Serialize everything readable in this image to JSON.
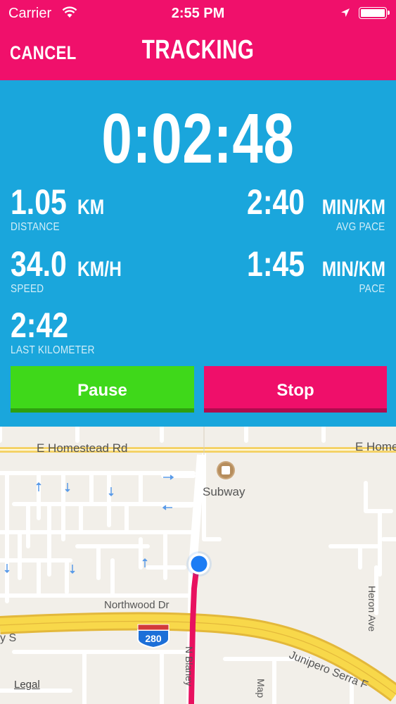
{
  "status_bar": {
    "carrier": "Carrier",
    "time": "2:55 PM"
  },
  "nav": {
    "cancel_label": "CANCEL",
    "title": "TRACKING"
  },
  "tracking": {
    "elapsed": "0:02:48",
    "distance": {
      "value": "1.05",
      "unit": "KM",
      "label": "DISTANCE"
    },
    "avg_pace": {
      "value": "2:40",
      "unit": "MIN/KM",
      "label": "AVG PACE"
    },
    "speed": {
      "value": "34.0",
      "unit": "KM/H",
      "label": "SPEED"
    },
    "pace": {
      "value": "1:45",
      "unit": "MIN/KM",
      "label": "PACE"
    },
    "last_km": {
      "value": "2:42",
      "label": "LAST KILOMETER"
    }
  },
  "actions": {
    "pause_label": "Pause",
    "stop_label": "Stop"
  },
  "map": {
    "road_homestead_left": "E Homestead Rd",
    "road_homestead_right": "E Home",
    "poi_subway": "Subway",
    "road_northwood": "Northwood Dr",
    "highway_shield": "280",
    "road_left_fragment": "y S",
    "road_junipero": "Junipero Serra F",
    "road_heron": "Heron Ave",
    "road_map_fragment": "Map",
    "road_blaney_fragment": "N Blaney",
    "legal": "Legal"
  },
  "colors": {
    "accent_pink": "#f0106b",
    "stats_blue": "#1aa6dc",
    "pause_green": "#3fd81a",
    "route": "#e8115f",
    "location_dot": "#1c7cf4"
  },
  "icons": [
    "wifi-icon",
    "location-arrow-icon",
    "battery-icon",
    "restaurant-icon",
    "user-location-icon"
  ]
}
